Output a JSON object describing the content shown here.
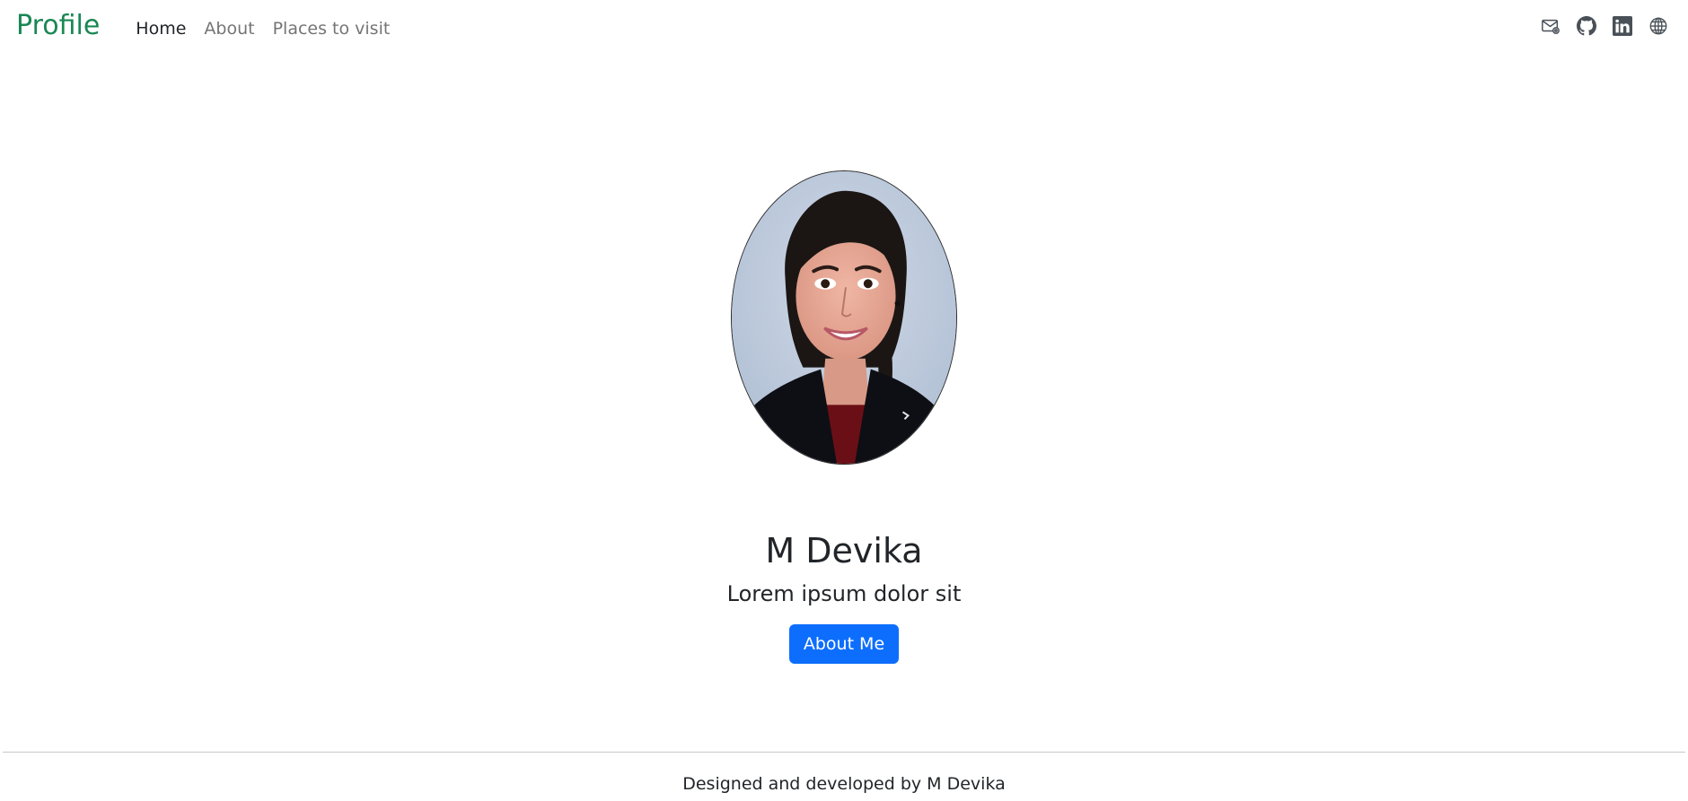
{
  "navbar": {
    "brand": "Profile",
    "brand_color": "#198754",
    "links": [
      {
        "label": "Home",
        "active": true
      },
      {
        "label": "About",
        "active": false
      },
      {
        "label": "Places to visit",
        "active": false
      }
    ],
    "icons": [
      "envelope-at-icon",
      "github-icon",
      "linkedin-icon",
      "globe-icon"
    ]
  },
  "hero": {
    "name": "M Devika",
    "tagline": "Lorem ipsum dolor sit",
    "button_label": "About Me",
    "button_color": "#0d6efd"
  },
  "footer": {
    "text": "Designed and developed by M Devika"
  }
}
